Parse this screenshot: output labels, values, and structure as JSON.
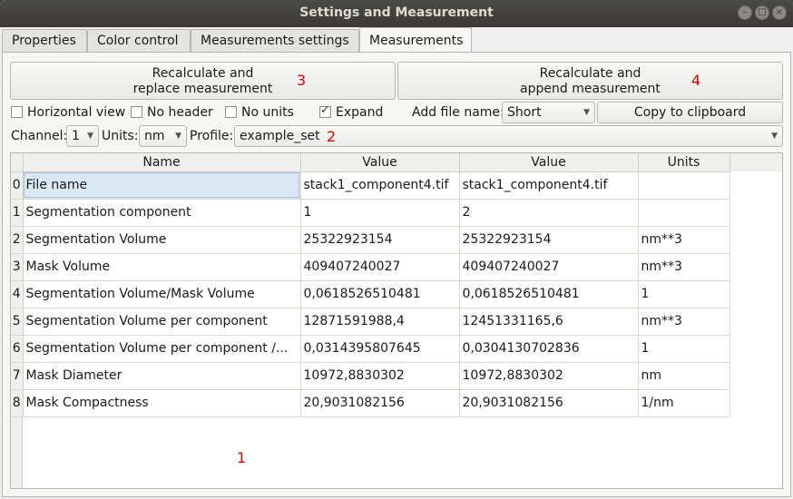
{
  "window": {
    "title": "Settings and Measurement"
  },
  "tabs": [
    {
      "label": "Properties"
    },
    {
      "label": "Color control"
    },
    {
      "label": "Measurements settings"
    },
    {
      "label": "Measurements"
    }
  ],
  "actions": {
    "recalc_replace": {
      "line1": "Recalculate and",
      "line2": "replace measurement",
      "marker": "3"
    },
    "recalc_append": {
      "line1": "Recalculate and",
      "line2": "append measurement",
      "marker": "4"
    }
  },
  "options": {
    "horizontal_view": {
      "label": "Horizontal view",
      "checked": false
    },
    "no_header": {
      "label": "No header",
      "checked": false
    },
    "no_units": {
      "label": "No units",
      "checked": false
    },
    "expand": {
      "label": "Expand",
      "checked": true
    },
    "add_file_name_label": "Add file name:",
    "add_file_name_value": "Short",
    "copy_button": "Copy to clipboard"
  },
  "selectors": {
    "channel_label": "Channel:",
    "channel_value": "1",
    "units_label": "Units:",
    "units_value": "nm",
    "profile_label": "Profile:",
    "profile_value": "example_set",
    "profile_marker": "2"
  },
  "table": {
    "headers": [
      "Name",
      "Value",
      "Value",
      "Units"
    ],
    "rows": [
      {
        "index": "0",
        "name": "File name",
        "v1": "stack1_component4.tif",
        "v2": "stack1_component4.tif",
        "units": ""
      },
      {
        "index": "1",
        "name": "Segmentation component",
        "v1": "1",
        "v2": "2",
        "units": ""
      },
      {
        "index": "2",
        "name": "Segmentation Volume",
        "v1": "25322923154",
        "v2": "25322923154",
        "units": "nm**3"
      },
      {
        "index": "3",
        "name": "Mask Volume",
        "v1": "409407240027",
        "v2": "409407240027",
        "units": "nm**3"
      },
      {
        "index": "4",
        "name": "Segmentation Volume/Mask Volume",
        "v1": "0,0618526510481",
        "v2": "0,0618526510481",
        "units": "1"
      },
      {
        "index": "5",
        "name": "Segmentation Volume per component",
        "v1": "12871591988,4",
        "v2": "12451331165,6",
        "units": "nm**3"
      },
      {
        "index": "6",
        "name": "Segmentation Volume per component /...",
        "v1": "0,0314395807645",
        "v2": "0,0304130702836",
        "units": "1"
      },
      {
        "index": "7",
        "name": "Mask Diameter",
        "v1": "10972,8830302",
        "v2": "10972,8830302",
        "units": "nm"
      },
      {
        "index": "8",
        "name": "Mask Compactness",
        "v1": "20,9031082156",
        "v2": "20,9031082156",
        "units": "1/nm"
      }
    ],
    "marker": "1"
  }
}
